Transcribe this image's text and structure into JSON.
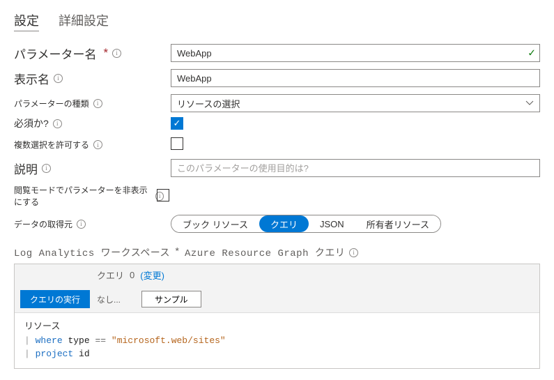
{
  "tabs": {
    "settings": "設定",
    "advanced": "詳細設定"
  },
  "labels": {
    "param_name": "パラメーター名",
    "display_name": "表示名",
    "param_type": "パラメーターの種類",
    "required": "必須か?",
    "multi": "複数選択を許可する",
    "description": "説明",
    "hide": "閲覧モードでパラメーターを非表示にする",
    "data_from": "データの取得元"
  },
  "values": {
    "param_name": "WebApp",
    "display_name": "WebApp",
    "param_type": "リソースの選択",
    "description_placeholder": "このパラメーターの使用目的は?",
    "required_checked": true,
    "multi_checked": false,
    "hide_checked": false
  },
  "pills": {
    "book": "ブック リソース",
    "query": "クエリ",
    "json": "JSON",
    "owner": "所有者リソース"
  },
  "querySection": {
    "title_prefix": "Log Analytics ワークスペース",
    "asterisk": "*",
    "title_suffix": "Azure Resource Graph クエリ",
    "toolbar_query_label": "クエリ",
    "toolbar_count": "0",
    "toolbar_change": "(変更)",
    "toolbar_none": "なし...",
    "run": "クエリの実行",
    "sample": "サンプル"
  },
  "code": {
    "line1": "リソース",
    "l2_kw": "where",
    "l2_id": "type",
    "l2_op": "==",
    "l2_str": "\"microsoft.web/sites\"",
    "l3_kw": "project",
    "l3_id": "id"
  }
}
